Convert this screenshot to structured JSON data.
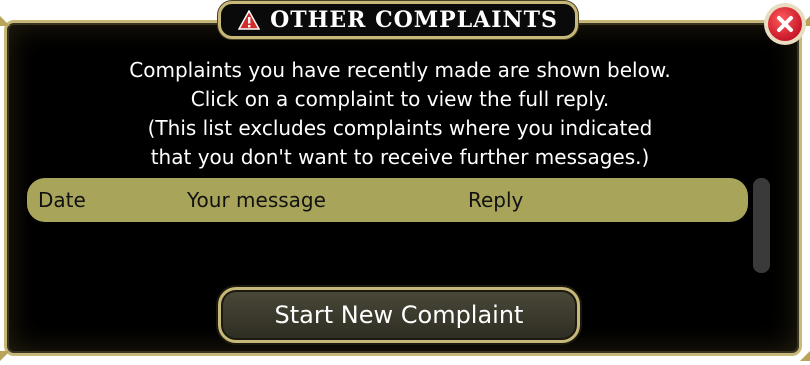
{
  "dialog": {
    "title": "OTHER COMPLAINTS",
    "title_icon": "warning-icon",
    "close_icon": "close-icon"
  },
  "intro": {
    "line1": "Complaints you have recently made are shown below.",
    "line2": "Click on a complaint to view the full reply.",
    "line3": "(This list excludes complaints where you indicated",
    "line4": "that you don't want to receive further messages.)"
  },
  "table": {
    "headers": {
      "date": "Date",
      "message": "Your message",
      "reply": "Reply"
    },
    "rows": []
  },
  "actions": {
    "start_new": "Start New Complaint"
  },
  "colors": {
    "frame": "#c7b778",
    "header_bg": "#a8a55a",
    "close": "#c8182a",
    "warning": "#d42a2a"
  }
}
